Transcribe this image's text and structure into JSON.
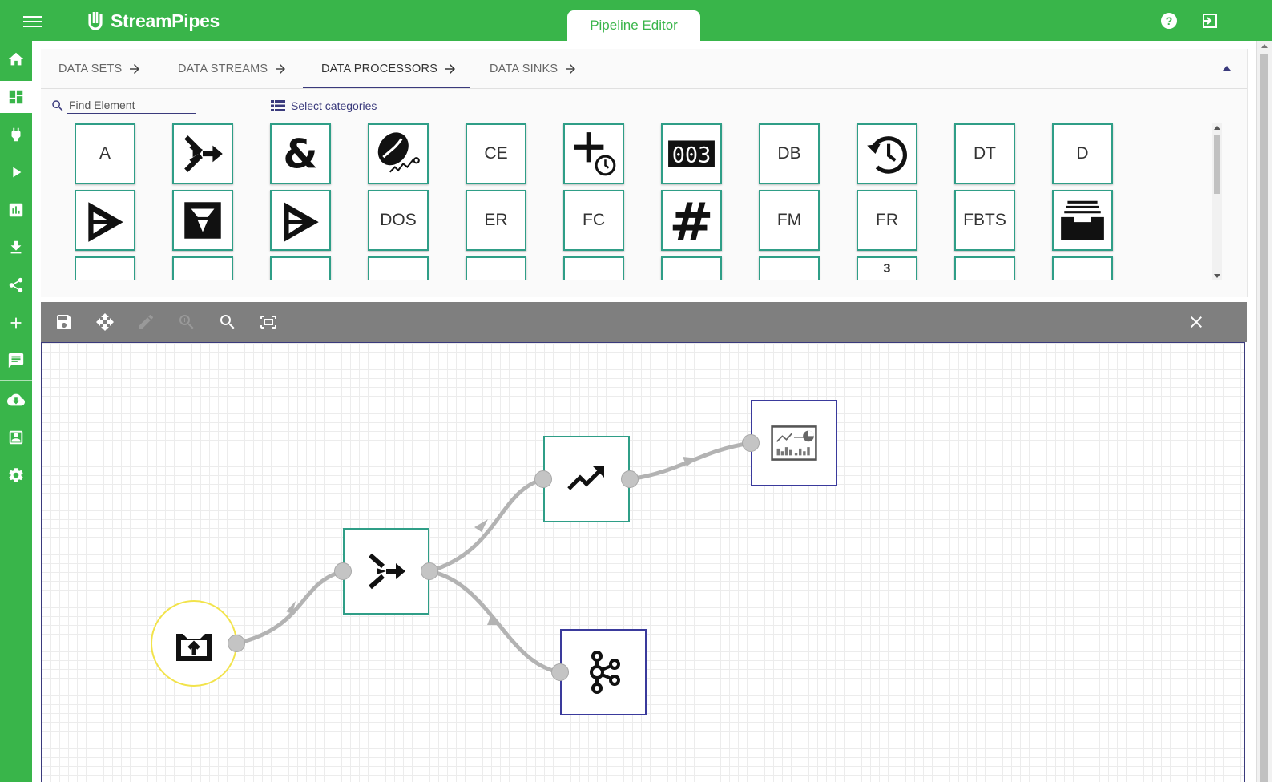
{
  "header": {
    "app_name": "StreamPipes",
    "page_title": "Pipeline Editor",
    "help_icon": "help-icon",
    "logout_icon": "logout-icon",
    "theme_color": "#39b54a"
  },
  "sidebar": {
    "items": [
      {
        "name": "home",
        "icon": "home-icon"
      },
      {
        "name": "pipeline-editor",
        "icon": "dashboard-icon",
        "active": true
      },
      {
        "name": "connect",
        "icon": "plug-icon"
      },
      {
        "name": "pipelines",
        "icon": "play-icon"
      },
      {
        "name": "dashboard",
        "icon": "bar-chart-icon"
      },
      {
        "name": "data-download",
        "icon": "download-icon"
      },
      {
        "name": "app-overview",
        "icon": "share-icon"
      },
      {
        "name": "add",
        "icon": "plus-icon"
      },
      {
        "name": "notifications",
        "icon": "chat-icon"
      },
      {
        "name": "install",
        "icon": "cloud-download-icon"
      },
      {
        "name": "my-elements",
        "icon": "contact-icon"
      },
      {
        "name": "configuration",
        "icon": "gear-icon"
      }
    ]
  },
  "element_tabs": [
    {
      "label": "DATA SETS"
    },
    {
      "label": "DATA STREAMS"
    },
    {
      "label": "DATA PROCESSORS",
      "active": true
    },
    {
      "label": "DATA SINKS"
    }
  ],
  "search": {
    "placeholder": "Find Element",
    "value": ""
  },
  "categories_label": "Select categories",
  "elements": [
    {
      "label": "A"
    },
    {
      "icon": "merge-icon"
    },
    {
      "icon": "ampersand-icon"
    },
    {
      "icon": "coffee-bean-icon"
    },
    {
      "label": "CE"
    },
    {
      "icon": "add-timer-icon"
    },
    {
      "icon": "counter-icon"
    },
    {
      "label": "DB"
    },
    {
      "icon": "history-clock-icon"
    },
    {
      "label": "DT"
    },
    {
      "label": "D"
    },
    {
      "icon": "funnel-triangle-icon"
    },
    {
      "icon": "filter-box-icon"
    },
    {
      "icon": "funnel-triangle-icon"
    },
    {
      "label": "DOS"
    },
    {
      "label": "ER"
    },
    {
      "label": "FC"
    },
    {
      "icon": "hashtag-icon"
    },
    {
      "label": "FM"
    },
    {
      "label": "FR"
    },
    {
      "label": "FBTS"
    },
    {
      "icon": "inbox-tray-icon"
    },
    {
      "label": ""
    },
    {
      "label": ""
    },
    {
      "label": ""
    },
    {
      "label": ""
    },
    {
      "label": ""
    },
    {
      "label": ""
    },
    {
      "label": ""
    },
    {
      "label": ""
    },
    {
      "label": "3"
    },
    {
      "label": ""
    },
    {
      "label": ""
    }
  ],
  "toolbar": {
    "buttons": [
      "save-icon",
      "move-icon",
      "edit-icon",
      "zoom-in-icon",
      "zoom-out-icon",
      "fit-screen-icon"
    ],
    "close": "close-icon"
  },
  "pipeline": {
    "nodes": [
      {
        "id": "stream",
        "type": "stream",
        "icon": "upload-tray-icon"
      },
      {
        "id": "merge",
        "type": "processor",
        "icon": "merge-icon"
      },
      {
        "id": "trend",
        "type": "processor",
        "icon": "trending-up-icon"
      },
      {
        "id": "dashboard",
        "type": "sink",
        "icon": "dashboard-chart-icon"
      },
      {
        "id": "kafka",
        "type": "sink",
        "icon": "kafka-icon"
      }
    ],
    "edges": [
      [
        "stream",
        "merge"
      ],
      [
        "merge",
        "trend"
      ],
      [
        "merge",
        "kafka"
      ],
      [
        "trend",
        "dashboard"
      ]
    ]
  }
}
